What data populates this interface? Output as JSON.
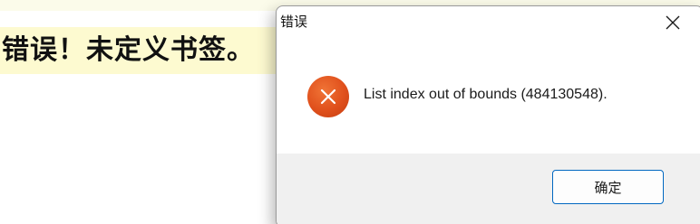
{
  "document": {
    "error_text": "错误！未定义书签。"
  },
  "dialog": {
    "title": "错误",
    "message": "List index out of bounds (484130548).",
    "ok_label": "确定",
    "icons": {
      "close": "close-icon",
      "status": "error-icon"
    },
    "colors": {
      "error_icon": "#e0501c",
      "ok_border": "#0067c0",
      "footer_bg": "#f0f0f0",
      "highlight_bg": "#fdfad0"
    }
  }
}
